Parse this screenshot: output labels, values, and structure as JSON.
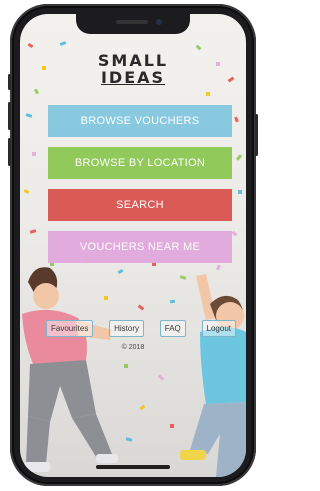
{
  "app": {
    "logo_line1": "SMALL",
    "logo_line2": "IDEAS"
  },
  "menu": {
    "browse_vouchers": "BROWSE VOUCHERS",
    "browse_by_location": "BROWSE BY LOCATION",
    "search": "SEARCH",
    "vouchers_near_me": "VOUCHERS NEAR ME"
  },
  "footer": {
    "favourites": "Favourites",
    "history": "History",
    "faq": "FAQ",
    "logout": "Logout",
    "copyright": "© 2018"
  },
  "colors": {
    "browse_vouchers": "#82c7e0",
    "browse_by_location": "#8dc854",
    "search": "#d9534f",
    "vouchers_near_me": "#e2a8dd",
    "footer_border": "#7fb5cc"
  }
}
